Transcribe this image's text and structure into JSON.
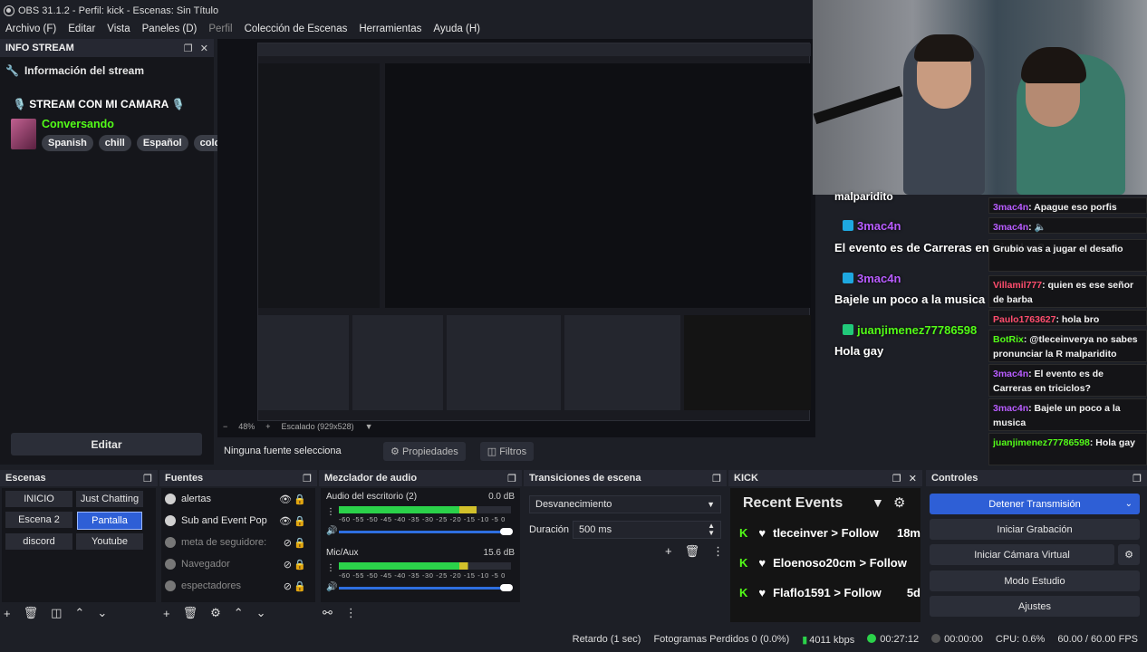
{
  "window": {
    "title": "OBS 31.1.2 - Perfil: kick - Escenas: Sin Título"
  },
  "menu": [
    {
      "label": "Archivo (F)",
      "dim": false
    },
    {
      "label": "Editar",
      "dim": false
    },
    {
      "label": "Vista",
      "dim": false
    },
    {
      "label": "Paneles (D)",
      "dim": false
    },
    {
      "label": "Perfil",
      "dim": true
    },
    {
      "label": "Colección de Escenas",
      "dim": false
    },
    {
      "label": "Herramientas",
      "dim": false
    },
    {
      "label": "Ayuda (H)",
      "dim": false
    }
  ],
  "info_dock": {
    "header": "INFO STREAM",
    "title": "Información del stream",
    "stream_name": "🎙️ STREAM CON MI CAMARA 🎙️",
    "category": "Conversando",
    "tags": [
      "Spanish",
      "chill",
      "Español",
      "color"
    ],
    "edit_label": "Editar"
  },
  "preview": {
    "zoom": "48%",
    "scale_label": "Escalado (929x528)",
    "no_source": "Ninguna fuente selecciona",
    "properties_label": "Propiedades",
    "filters_label": "Filtros"
  },
  "overlay_chat": {
    "l1_user": "malparidito",
    "l2_user": "3mac4n",
    "l3_text": "El evento es de Carreras en triciclos?",
    "l4_user": "3mac4n",
    "l5_text": "Bajele un poco a la musica",
    "l6_user": "juanjimenez77786598",
    "l7_text": "Hola gay"
  },
  "side_chat": [
    {
      "user": "3mac4n",
      "text": ": Apague eso porfis",
      "color": "#b85cff"
    },
    {
      "user": "3mac4n",
      "text": ":",
      "color": "#b85cff"
    },
    {
      "user": "",
      "text": "Grubio vas a jugar el desafio",
      "color": "#e6e6e6"
    },
    {
      "user": "Villamil777",
      "text": ": quien es ese señor de barba",
      "color": "#ff4d6d"
    },
    {
      "user": "Paulo1763627",
      "text": ": hola bro",
      "color": "#ff4d6d"
    },
    {
      "user": "BotRix",
      "text": ": @tleceinverya no sabes pronunciar la R malparidito",
      "color": "#53fc18"
    },
    {
      "user": "3mac4n",
      "text": ": El evento es de Carreras en triciclos?",
      "color": "#b85cff"
    },
    {
      "user": "3mac4n",
      "text": ": Bajele un poco a la musica",
      "color": "#b85cff"
    },
    {
      "user": "juanjimenez77786598",
      "text": ": Hola gay",
      "color": "#53fc18"
    }
  ],
  "scenes": {
    "header": "Escenas",
    "items": [
      {
        "label": "INICIO",
        "selected": false
      },
      {
        "label": "Just Chatting",
        "selected": false
      },
      {
        "label": "Escena 2",
        "selected": false
      },
      {
        "label": "Pantalla",
        "selected": true
      },
      {
        "label": "discord",
        "selected": false
      },
      {
        "label": "Youtube",
        "selected": false
      }
    ]
  },
  "sources": {
    "header": "Fuentes",
    "items": [
      {
        "label": "alertas",
        "visible": true
      },
      {
        "label": "Sub and Event Pop",
        "visible": true
      },
      {
        "label": "meta de seguidore:",
        "visible": false
      },
      {
        "label": "Navegador",
        "visible": false
      },
      {
        "label": "espectadores",
        "visible": false
      }
    ]
  },
  "mixer": {
    "header": "Mezclador de audio",
    "channels": [
      {
        "name": "Audio del escritorio (2)",
        "db": "0.0 dB",
        "level": 0.8
      },
      {
        "name": "Mic/Aux",
        "db": "15.6 dB",
        "level": 0.75
      }
    ],
    "scale": "-60 -55 -50 -45 -40 -35 -30 -25 -20 -15 -10 -5 0"
  },
  "transitions": {
    "header": "Transiciones de escena",
    "selected": "Desvanecimiento",
    "duration_label": "Duración",
    "duration_value": "500 ms"
  },
  "kick": {
    "header": "KICK",
    "title": "Recent Events",
    "events": [
      {
        "user": "tleceinver",
        "action": "Follow",
        "time": "18m"
      },
      {
        "user": "Eloenoso20cm",
        "action": "Follow",
        "time": ""
      },
      {
        "user": "Flaflo1591",
        "action": "Follow",
        "time": "5d"
      }
    ]
  },
  "controls": {
    "header": "Controles",
    "stop_stream": "Detener Transmisión",
    "start_record": "Iniciar Grabación",
    "virtual_cam": "Iniciar Cámara Virtual",
    "studio_mode": "Modo Estudio",
    "settings": "Ajustes"
  },
  "status": {
    "delay": "Retardo (1 sec)",
    "dropped": "Fotogramas Perdidos 0 (0.0%)",
    "bitrate": "4011 kbps",
    "stream_time": "00:27:12",
    "record_time": "00:00:00",
    "cpu": "CPU: 0.6%",
    "fps": "60.00 / 60.00 FPS"
  },
  "colors": {
    "accent": "#2e5fd6",
    "kick_green": "#53fc18",
    "chat_purple": "#b85cff"
  }
}
